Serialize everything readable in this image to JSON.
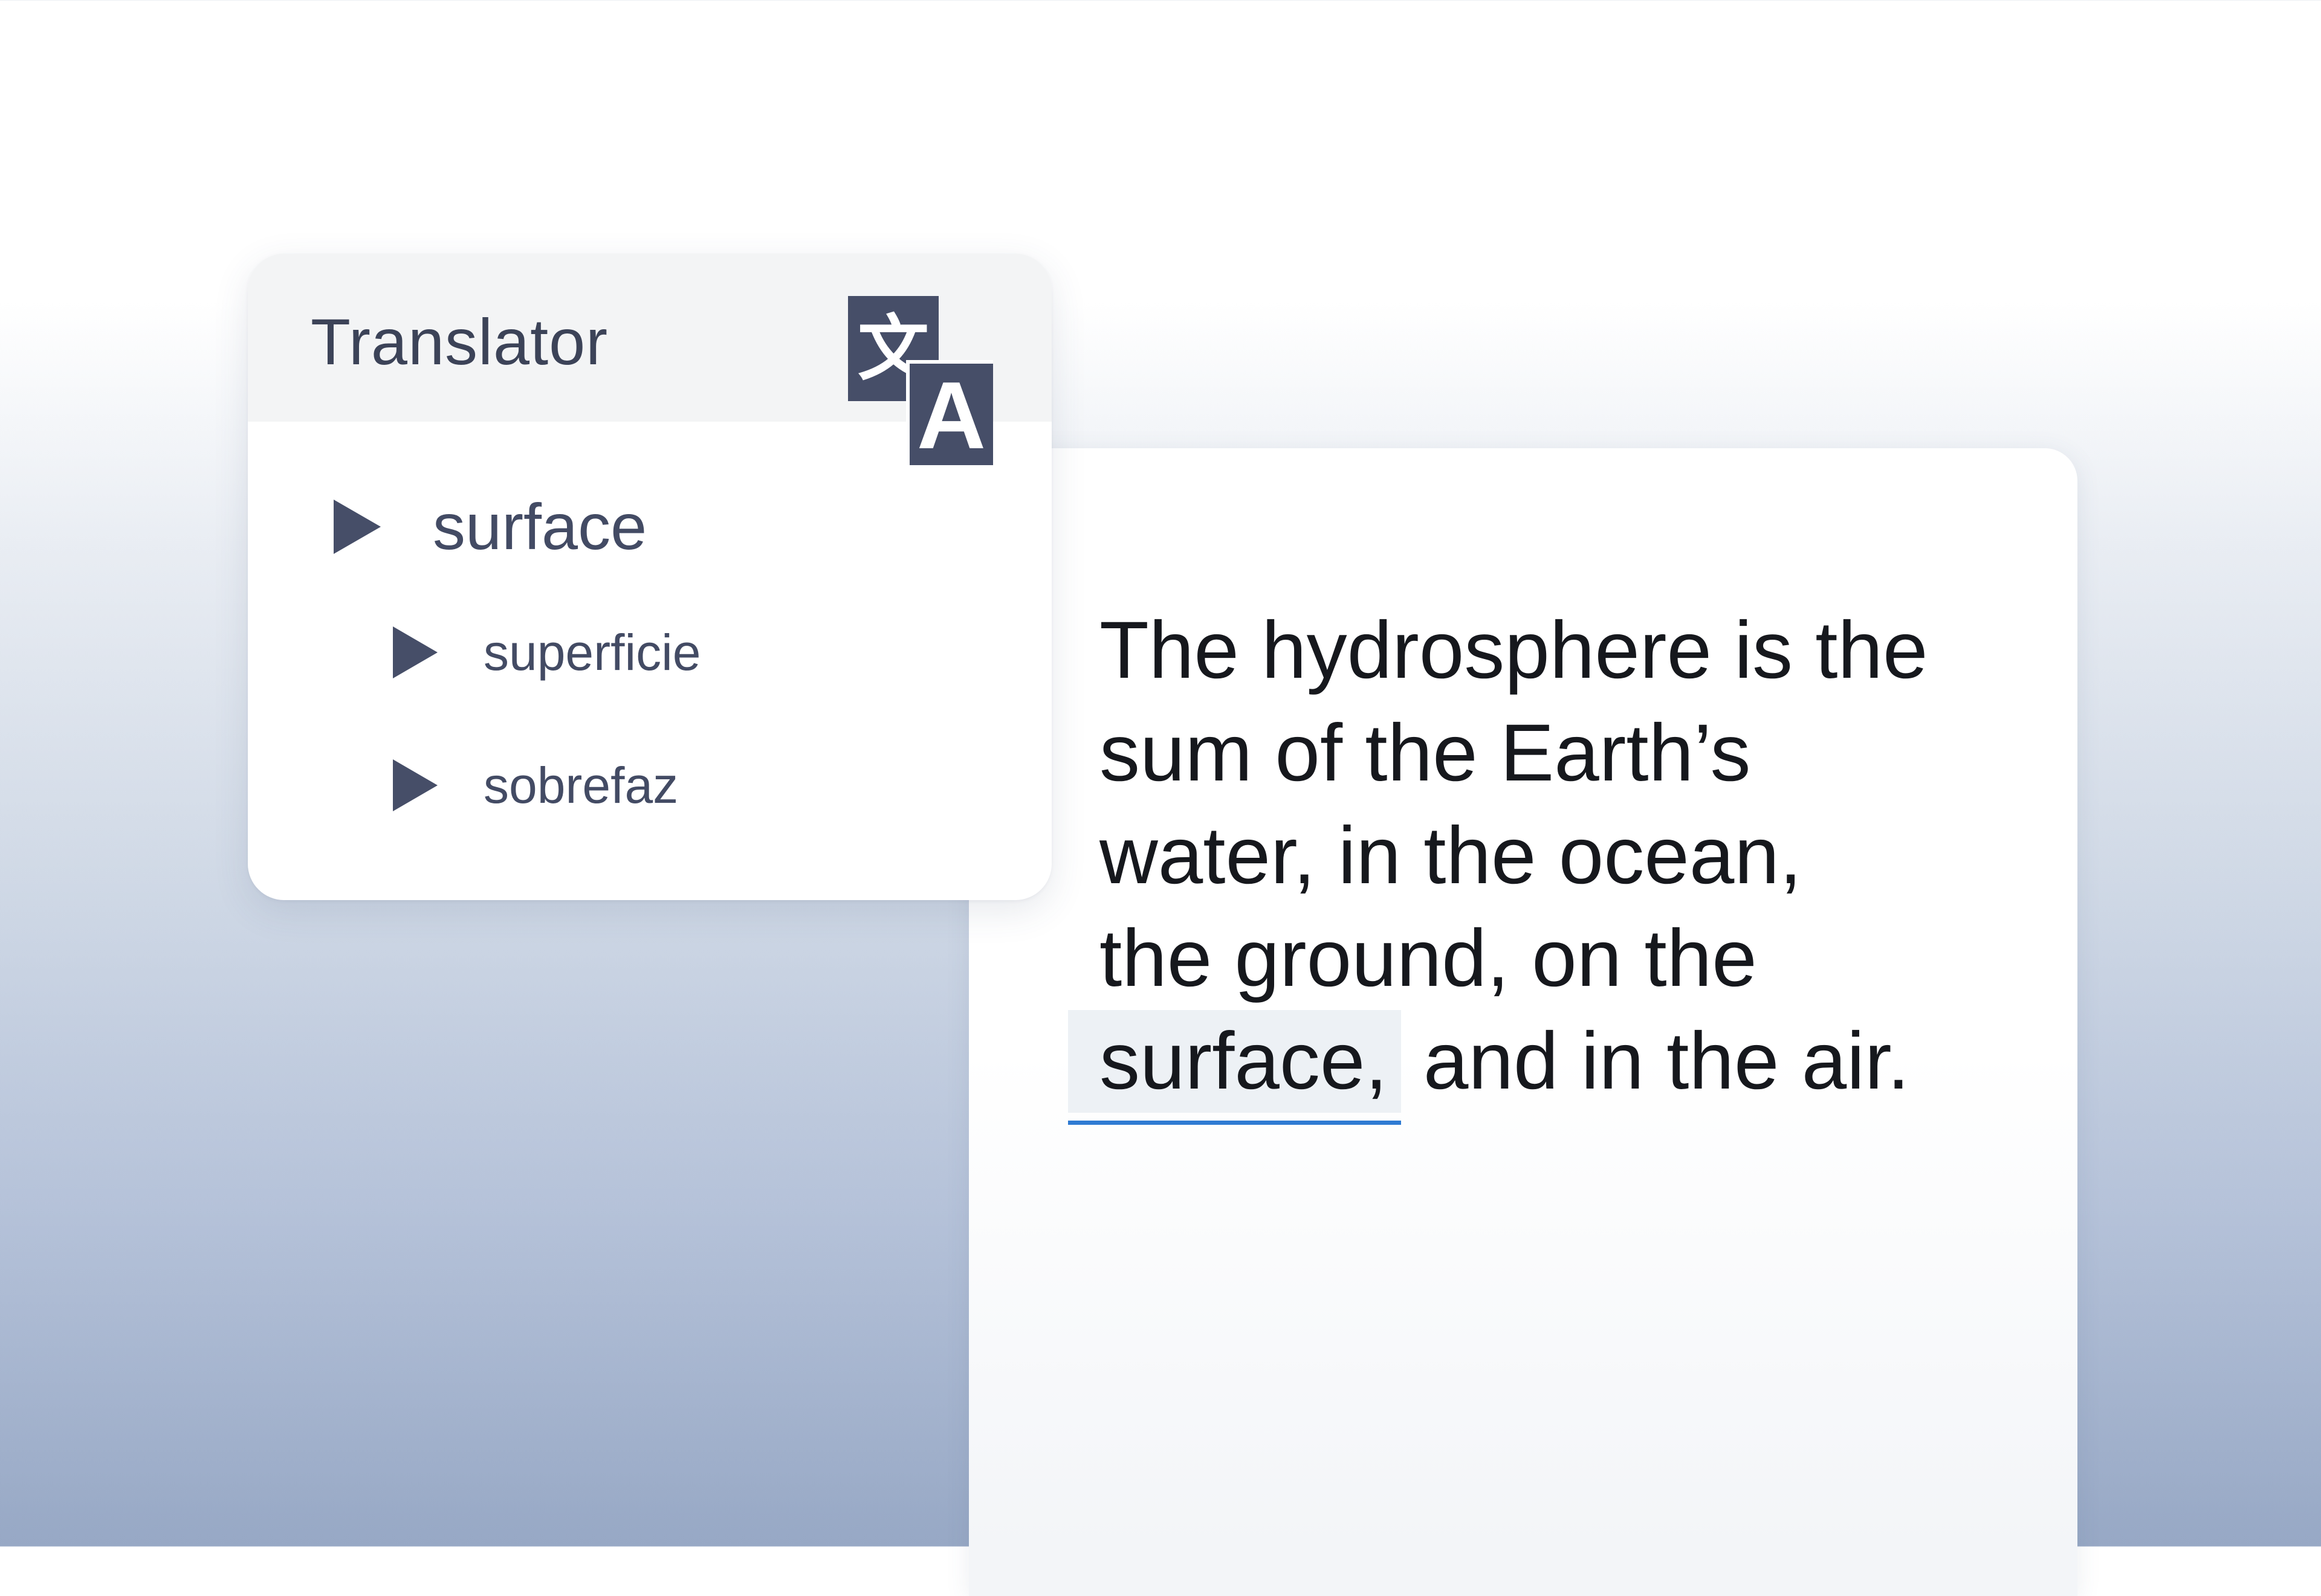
{
  "translator": {
    "title": "Translator",
    "icon": "translate-icon",
    "icon_glyphs": {
      "cjk": "文",
      "latin": "A"
    },
    "word": "surface",
    "translations": [
      "superficie",
      "sobrefaz"
    ]
  },
  "document": {
    "lines": [
      "The hydrosphere is the",
      "sum of the Earth’s",
      "water, in the ocean,",
      "the ground, on the"
    ],
    "last_line_highlight": "surface,",
    "last_line_rest": " and in the air."
  },
  "colors": {
    "accent_underline": "#2f7bd3",
    "icon_fill": "#464e68",
    "text_dark": "#16181d",
    "text_muted": "#3c4358"
  }
}
